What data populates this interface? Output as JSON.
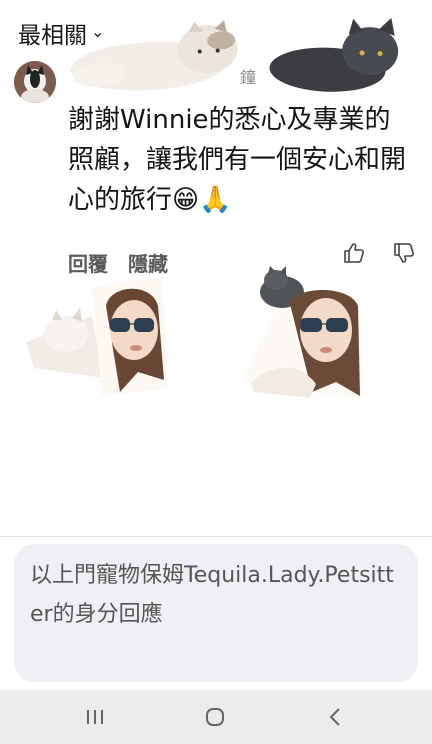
{
  "sort": {
    "label": "最相關",
    "icon": "chevron-down-icon"
  },
  "comment": {
    "time_fragment": "鐘",
    "text": "謝謝Winnie的悉心及專業的照顧，讓我們有一個安心和開心的旅行😁🙏",
    "actions": {
      "reply": "回覆",
      "hide": "隱藏"
    }
  },
  "reply_box": {
    "placeholder": "以上門寵物保姆Tequila.Lady.Petsitter的身分回應"
  },
  "nav": {
    "recent": "recent-apps-icon",
    "home": "home-icon",
    "back": "back-icon"
  }
}
